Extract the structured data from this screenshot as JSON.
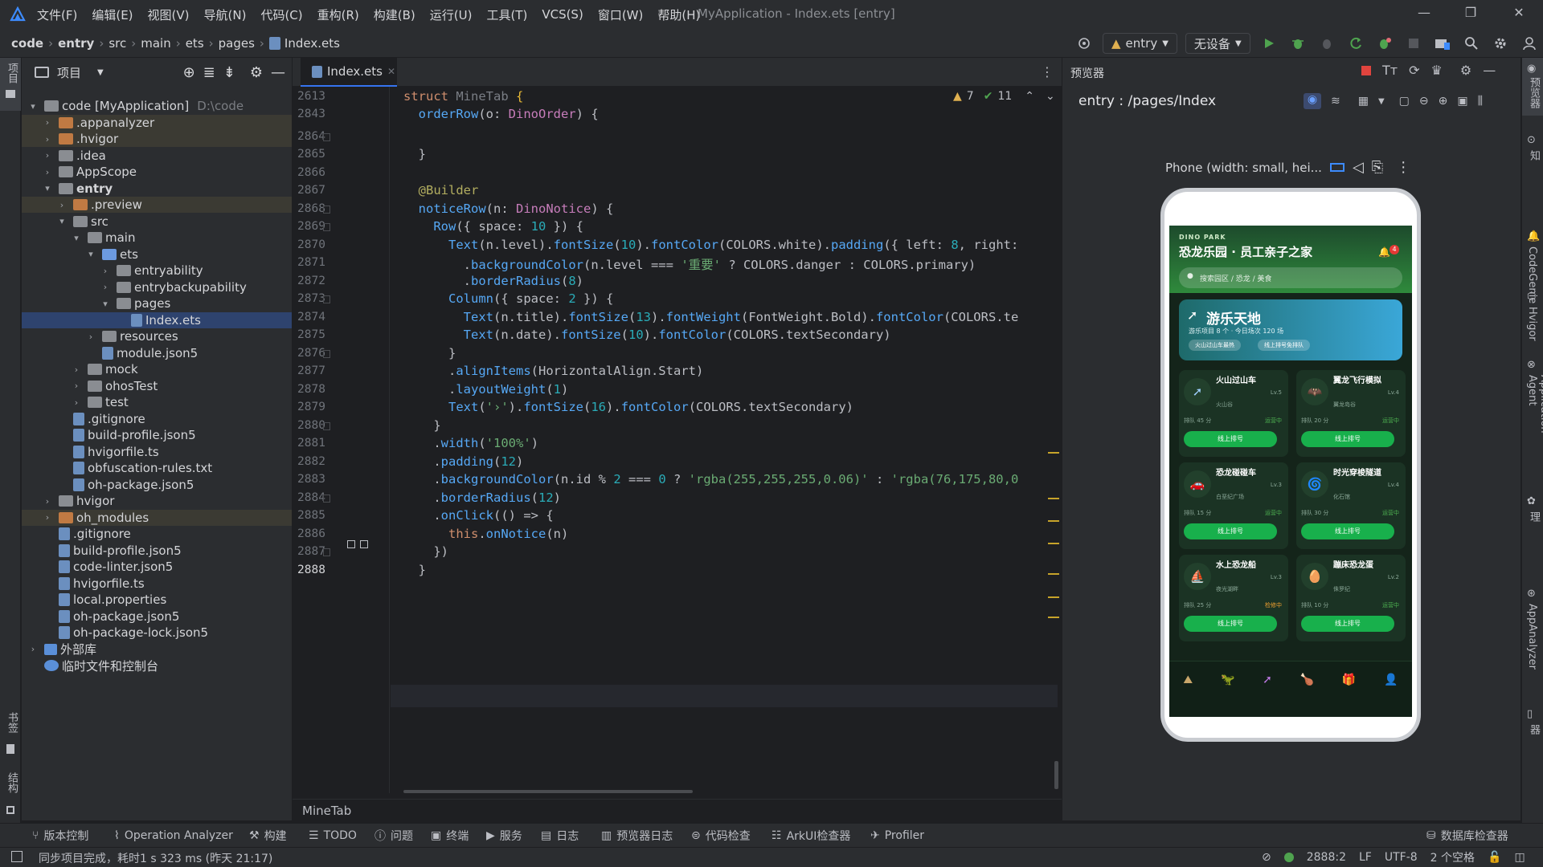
{
  "menubar": {
    "items": [
      "文件(F)",
      "编辑(E)",
      "视图(V)",
      "导航(N)",
      "代码(C)",
      "重构(R)",
      "构建(B)",
      "运行(U)",
      "工具(T)",
      "VCS(S)",
      "窗口(W)",
      "帮助(H)"
    ],
    "title": "MyApplication - Index.ets [entry]"
  },
  "breadcrumb": [
    "code",
    "entry",
    "src",
    "main",
    "ets",
    "pages",
    "Index.ets"
  ],
  "run_toolbar": {
    "config": "entry",
    "device": "无设备"
  },
  "left_strip": {
    "project": "项目",
    "bookmarks": "书签",
    "structure": "结构"
  },
  "project": {
    "title": "项目",
    "tree": [
      {
        "label": "code [MyApplication]",
        "extra": "D:\\code",
        "depth": 0,
        "arrow": "▾",
        "icon": "folder"
      },
      {
        "label": ".appanalyzer",
        "depth": 1,
        "arrow": "›",
        "icon": "folder-orange",
        "bg": "ex"
      },
      {
        "label": ".hvigor",
        "depth": 1,
        "arrow": "›",
        "icon": "folder-orange",
        "bg": "ex"
      },
      {
        "label": ".idea",
        "depth": 1,
        "arrow": "›",
        "icon": "folder"
      },
      {
        "label": "AppScope",
        "depth": 1,
        "arrow": "›",
        "icon": "folder"
      },
      {
        "label": "entry",
        "depth": 1,
        "arrow": "▾",
        "icon": "folder",
        "bold": true
      },
      {
        "label": ".preview",
        "depth": 2,
        "arrow": "›",
        "icon": "folder-orange",
        "bg": "ex"
      },
      {
        "label": "src",
        "depth": 2,
        "arrow": "▾",
        "icon": "folder"
      },
      {
        "label": "main",
        "depth": 3,
        "arrow": "▾",
        "icon": "folder"
      },
      {
        "label": "ets",
        "depth": 4,
        "arrow": "▾",
        "icon": "folder-blue"
      },
      {
        "label": "entryability",
        "depth": 5,
        "arrow": "›",
        "icon": "folder"
      },
      {
        "label": "entrybackupability",
        "depth": 5,
        "arrow": "›",
        "icon": "folder"
      },
      {
        "label": "pages",
        "depth": 5,
        "arrow": "▾",
        "icon": "folder"
      },
      {
        "label": "Index.ets",
        "depth": 6,
        "arrow": "",
        "icon": "file",
        "bg": "hl"
      },
      {
        "label": "resources",
        "depth": 4,
        "arrow": "›",
        "icon": "folder"
      },
      {
        "label": "module.json5",
        "depth": 4,
        "arrow": "",
        "icon": "file"
      },
      {
        "label": "mock",
        "depth": 3,
        "arrow": "›",
        "icon": "folder"
      },
      {
        "label": "ohosTest",
        "depth": 3,
        "arrow": "›",
        "icon": "folder"
      },
      {
        "label": "test",
        "depth": 3,
        "arrow": "›",
        "icon": "folder"
      },
      {
        "label": ".gitignore",
        "depth": 2,
        "arrow": "",
        "icon": "file"
      },
      {
        "label": "build-profile.json5",
        "depth": 2,
        "arrow": "",
        "icon": "file"
      },
      {
        "label": "hvigorfile.ts",
        "depth": 2,
        "arrow": "",
        "icon": "file"
      },
      {
        "label": "obfuscation-rules.txt",
        "depth": 2,
        "arrow": "",
        "icon": "file"
      },
      {
        "label": "oh-package.json5",
        "depth": 2,
        "arrow": "",
        "icon": "file"
      },
      {
        "label": "hvigor",
        "depth": 1,
        "arrow": "›",
        "icon": "folder"
      },
      {
        "label": "oh_modules",
        "depth": 1,
        "arrow": "›",
        "icon": "folder-orange",
        "bg": "ex"
      },
      {
        "label": ".gitignore",
        "depth": 1,
        "arrow": "",
        "icon": "file"
      },
      {
        "label": "build-profile.json5",
        "depth": 1,
        "arrow": "",
        "icon": "file"
      },
      {
        "label": "code-linter.json5",
        "depth": 1,
        "arrow": "",
        "icon": "file"
      },
      {
        "label": "hvigorfile.ts",
        "depth": 1,
        "arrow": "",
        "icon": "file"
      },
      {
        "label": "local.properties",
        "depth": 1,
        "arrow": "",
        "icon": "file"
      },
      {
        "label": "oh-package.json5",
        "depth": 1,
        "arrow": "",
        "icon": "file"
      },
      {
        "label": "oh-package-lock.json5",
        "depth": 1,
        "arrow": "",
        "icon": "file"
      },
      {
        "label": "外部库",
        "depth": 0,
        "arrow": "›",
        "icon": "lib"
      },
      {
        "label": "临时文件和控制台",
        "depth": 0,
        "arrow": "",
        "icon": "scratch"
      }
    ]
  },
  "editor": {
    "tab": "Index.ets",
    "warnings": "7",
    "weak_warnings": "11",
    "breadcrumb": "MineTab",
    "line_numbers": [
      "2613",
      "2843",
      "2864",
      "2865",
      "2866",
      "2867",
      "2868",
      "2869",
      "2870",
      "2871",
      "2872",
      "2873",
      "2874",
      "2875",
      "2876",
      "2877",
      "2878",
      "2879",
      "2880",
      "2881",
      "2882",
      "2883",
      "2884",
      "2885",
      "2886",
      "2887",
      "2888"
    ],
    "lines": [
      "<span class=\"k\">struct</span> <span class=\"g\">MineTab</span> <span style=\"color:#e8ba36\">{</span>",
      "  <span class=\"f\">orderRow</span>(o: <span class=\"t\">DinoOrder</span>) {",
      "",
      "  }",
      "",
      "  <span class=\"a\">@Builder</span>",
      "  <span class=\"f\">noticeRow</span>(n: <span class=\"t\">DinoNotice</span>) {",
      "    <span class=\"f\">Row</span>({ space: <span class=\"n\">10</span> }) {",
      "      <span class=\"f\">Text</span>(n.level).<span class=\"f\">fontSize</span>(<span class=\"n\">10</span>).<span class=\"f\">fontColor</span>(COLORS.white).<span class=\"f\">padding</span>({ left: <span class=\"n\">8</span>, right:",
      "        .<span class=\"f\">backgroundColor</span>(n.level === <span class=\"s\">'重要'</span> ? COLORS.danger : COLORS.primary)",
      "        .<span class=\"f\">borderRadius</span>(<span class=\"n\">8</span>)",
      "      <span class=\"f\">Column</span>({ space: <span class=\"n\">2</span> }) {",
      "        <span class=\"f\">Text</span>(n.title).<span class=\"f\">fontSize</span>(<span class=\"n\">13</span>).<span class=\"f\">fontWeight</span>(FontWeight.Bold).<span class=\"f\">fontColor</span>(COLORS.te",
      "        <span class=\"f\">Text</span>(n.date).<span class=\"f\">fontSize</span>(<span class=\"n\">10</span>).<span class=\"f\">fontColor</span>(COLORS.textSecondary)",
      "      }",
      "      .<span class=\"f\">alignItems</span>(HorizontalAlign.Start)",
      "      .<span class=\"f\">layoutWeight</span>(<span class=\"n\">1</span>)",
      "      <span class=\"f\">Text</span>(<span class=\"s\">'›'</span>).<span class=\"f\">fontSize</span>(<span class=\"n\">16</span>).<span class=\"f\">fontColor</span>(COLORS.textSecondary)",
      "    }",
      "    .<span class=\"f\">width</span>(<span class=\"s\">'100%'</span>)",
      "    .<span class=\"f\">padding</span>(<span class=\"n\">12</span>)",
      "    .<span class=\"f\">backgroundColor</span>(n.id % <span class=\"n\">2</span> === <span class=\"n\">0</span> ? <span class=\"s\">'rgba(255,255,255,0.06)'</span> : <span class=\"s\">'rgba(76,175,80,0</span>",
      "    .<span class=\"f\">borderRadius</span>(<span class=\"n\">12</span>)",
      "    .<span class=\"f\">onClick</span>(() => {",
      "      <span class=\"k\">this</span>.<span class=\"f\">onNotice</span>(n)",
      "    })",
      "  }",
      "<span style=\"color:#e8ba36\">}</span>"
    ]
  },
  "preview": {
    "title": "预览器",
    "path": "entry : /pages/Index",
    "device": "Phone (width: small, hei...",
    "app": {
      "brand": "DINO PARK",
      "title": "恐龙乐园 · 员工亲子之家",
      "badge": "4",
      "search": "搜索园区 / 恐龙 / 美食",
      "banner_title": "游乐天地",
      "banner_sub": "游乐项目 8 个 · 今日场次 120 场",
      "chip1": "火山过山车最热",
      "chip2": "线上排号免排队",
      "cards": [
        {
          "name": "火山过山车",
          "sub": "火山谷",
          "lv": "Lv.5",
          "queue": "排队 45 分",
          "status": "运营中",
          "btn": "线上排号"
        },
        {
          "name": "翼龙飞行模拟",
          "sub": "翼龙岛谷",
          "lv": "Lv.4",
          "queue": "排队 20 分",
          "status": "运营中",
          "btn": "线上排号"
        },
        {
          "name": "恐龙碰碰车",
          "sub": "白垩纪广场",
          "lv": "Lv.3",
          "queue": "排队 15 分",
          "status": "运营中",
          "btn": "线上排号"
        },
        {
          "name": "时光穿梭隧道",
          "sub": "化石馆",
          "lv": "Lv.4",
          "queue": "排队 30 分",
          "status": "运营中",
          "btn": "线上排号"
        },
        {
          "name": "水上恐龙船",
          "sub": "夜光湖畔",
          "lv": "Lv.3",
          "queue": "排队 25 分",
          "status": "检修中",
          "btn": "线上排号"
        },
        {
          "name": "蹦床恐龙蛋",
          "sub": "侏罗纪",
          "lv": "Lv.2",
          "queue": "排队 10 分",
          "status": "运营中",
          "btn": "线上排号"
        }
      ]
    }
  },
  "right_strip": [
    "通知",
    "CodeGenie",
    "Hvigor",
    "Application Agent",
    "问题助理",
    "AppAnalyzer",
    "设备文件浏览器"
  ],
  "bottom_tools": [
    "版本控制",
    "Operation Analyzer",
    "构建",
    "TODO",
    "问题",
    "终端",
    "服务",
    "日志",
    "预览器日志",
    "代码检查",
    "ArkUI检查器",
    "Profiler",
    "数据库检查器"
  ],
  "status": {
    "message": "同步项目完成，耗时1 s 323 ms (昨天 21:17)",
    "position": "2888:2",
    "line_sep": "LF",
    "encoding": "UTF-8",
    "indent": "2 个空格"
  },
  "colors": {
    "accent": "#3574f0",
    "run": "#4fa34f",
    "app_bg": "#14241a",
    "app_green": "#18b04c"
  }
}
